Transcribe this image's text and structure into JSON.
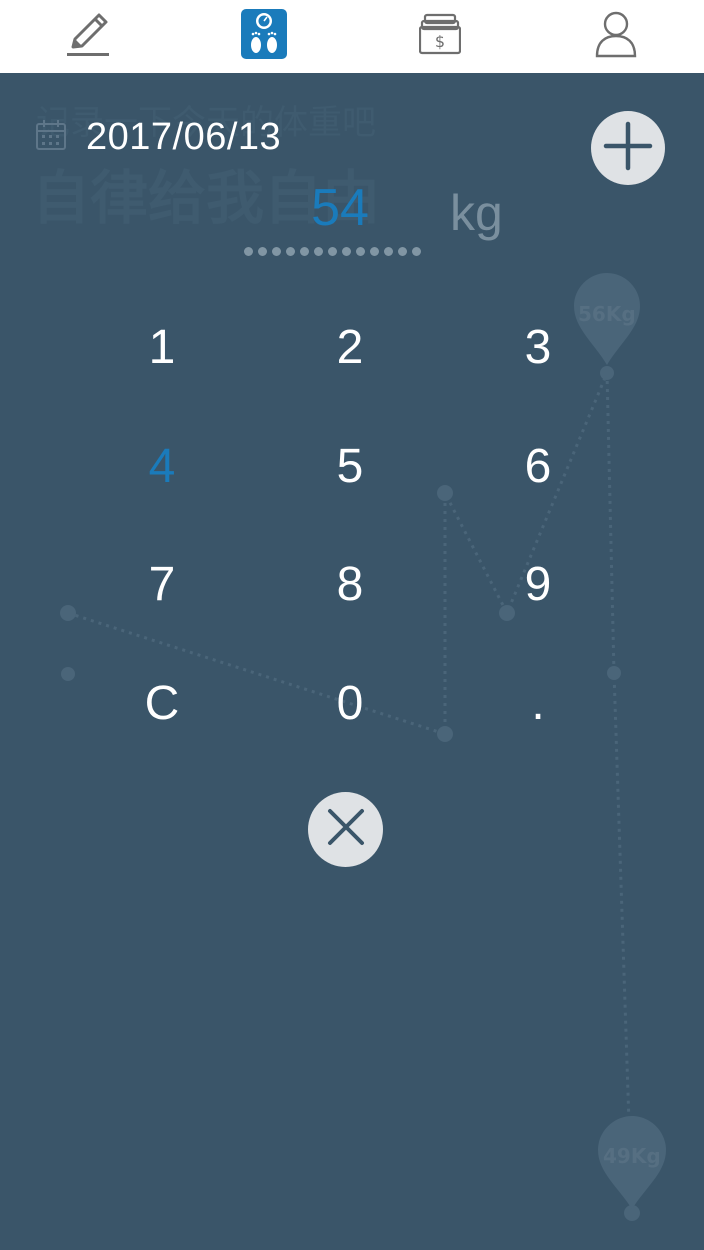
{
  "tabs": [
    {
      "name": "record",
      "icon": "pencil-icon",
      "active": false
    },
    {
      "name": "weight",
      "icon": "scale-icon",
      "active": true
    },
    {
      "name": "finance",
      "icon": "money-stack-icon",
      "active": false
    },
    {
      "name": "profile",
      "icon": "user-icon",
      "active": false
    }
  ],
  "background": {
    "subtitle": "记录一下今天的体重吧",
    "title": "自律给我自由",
    "pin_top_label": "56Kg",
    "pin_bottom_label": "49Kg"
  },
  "date": {
    "icon": "calendar-icon",
    "text": "2017/06/13"
  },
  "weight_input": {
    "value": "54",
    "unit": "kg"
  },
  "keypad": {
    "keys": [
      "1",
      "2",
      "3",
      "4",
      "5",
      "6",
      "7",
      "8",
      "9",
      "C",
      "0",
      "."
    ],
    "active_key": "4"
  },
  "colors": {
    "background": "#3a5569",
    "accent": "#1a7bbb",
    "button_fill": "#dfe2e5"
  }
}
